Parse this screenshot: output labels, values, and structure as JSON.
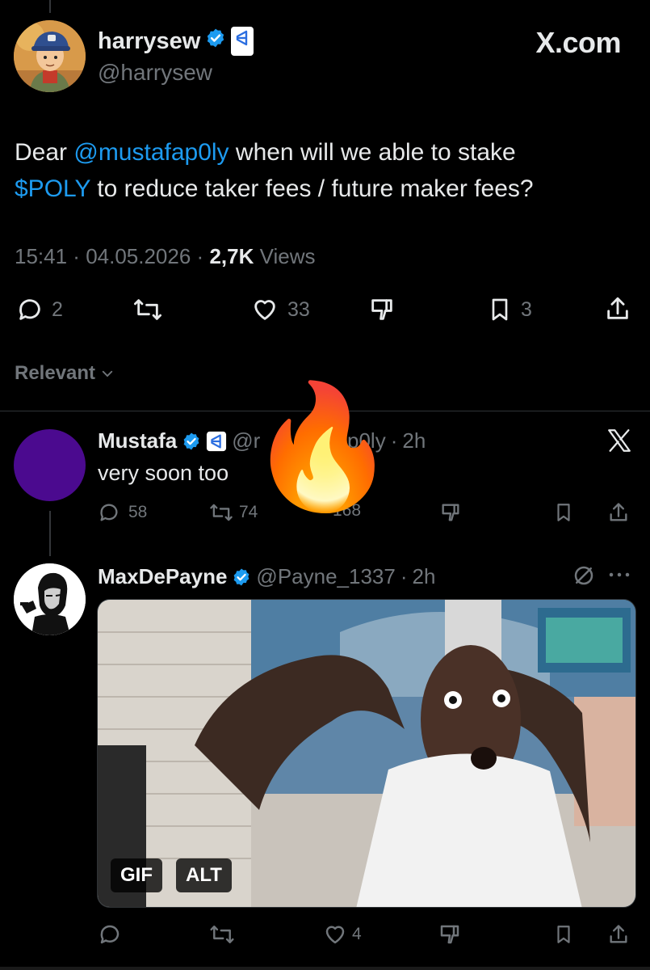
{
  "main_tweet": {
    "author_name": "harrysew",
    "author_handle": "@harrysew",
    "brand": "X.com",
    "text_prefix": "Dear ",
    "mention": "@mustafap0ly",
    "text_mid": " when will we able to stake",
    "cashtag": "$POLY",
    "text_suffix": " to reduce taker fees / future maker fees?",
    "time": "15:41",
    "date": "04.05.2026",
    "views_count": "2,7K",
    "views_label": "Views",
    "replies": "2",
    "likes": "33",
    "bookmarks": "3"
  },
  "sort": {
    "label": "Relevant"
  },
  "replies": [
    {
      "author_name": "Mustafa",
      "handle_start": "@r",
      "handle_end": "fap0ly",
      "time": "2h",
      "text": "very soon too",
      "emoji": "🔥",
      "replies": "58",
      "reposts": "74",
      "likes": "168"
    },
    {
      "author_name": "MaxDePayne",
      "author_handle": "@Payne_1337",
      "time": "2h",
      "gif_badge": "GIF",
      "alt_badge": "ALT",
      "likes": "4"
    }
  ],
  "colors": {
    "background": "#000000",
    "accent": "#1d9bf0",
    "muted": "#71767b",
    "reply_avatar": "#4b0a8f"
  }
}
